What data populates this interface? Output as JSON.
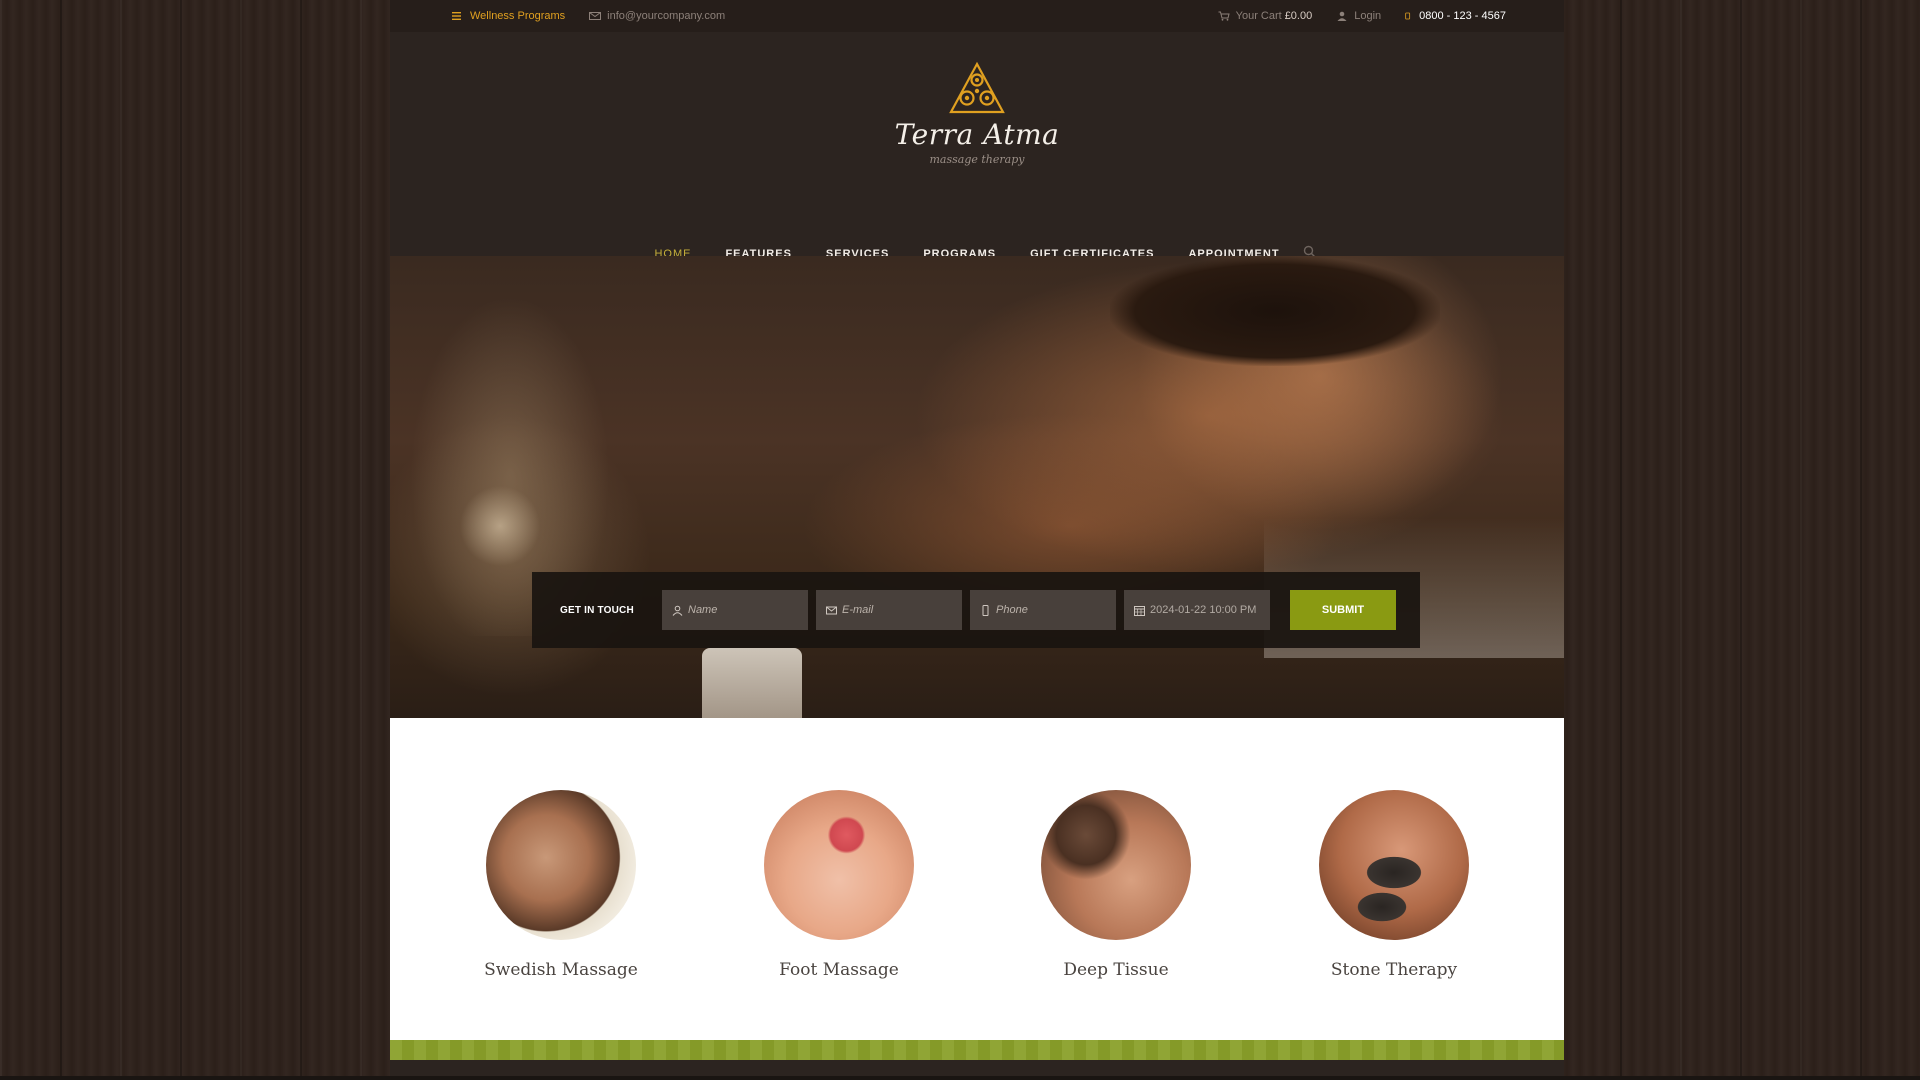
{
  "topbar": {
    "wellness_label": "Wellness Programs",
    "email": "info@yourcompany.com",
    "cart_label": "Your Cart",
    "cart_total": "£0.00",
    "login_label": "Login",
    "phone": "0800 - 123 - 4567"
  },
  "brand": {
    "title": "Terra Atma",
    "subtitle": "massage therapy",
    "accent": "#e0a020"
  },
  "nav": {
    "items": [
      {
        "label": "HOME"
      },
      {
        "label": "FEATURES"
      },
      {
        "label": "SERVICES"
      },
      {
        "label": "PROGRAMS"
      },
      {
        "label": "GIFT CERTIFICATES"
      },
      {
        "label": "APPOINTMENT"
      }
    ],
    "active": "HOME",
    "active_color": "#c7b03a"
  },
  "contact_form": {
    "title": "GET IN TOUCH",
    "name_placeholder": "Name",
    "email_placeholder": "E-mail",
    "phone_placeholder": "Phone",
    "date_value": "2024-01-22 10:00 PM",
    "submit_label": "SUBMIT",
    "submit_color": "#8a9a12"
  },
  "services": [
    {
      "label": "Swedish Massage",
      "icon": "woman-relaxing-image"
    },
    {
      "label": "Foot Massage",
      "icon": "foot-massage-image"
    },
    {
      "label": "Deep Tissue",
      "icon": "deep-tissue-image"
    },
    {
      "label": "Stone Therapy",
      "icon": "hot-stones-image"
    }
  ]
}
